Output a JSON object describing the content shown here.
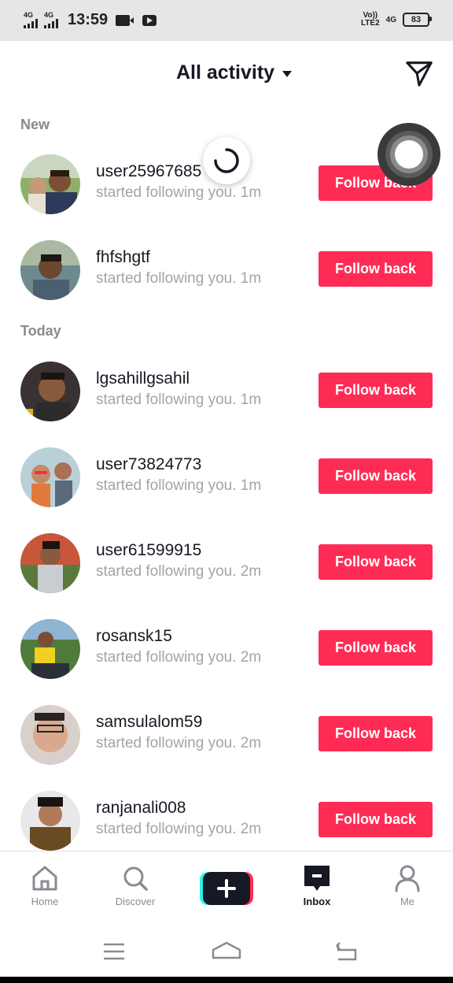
{
  "status_bar": {
    "network_1": "4G",
    "network_2": "4G",
    "time": "13:59",
    "volte_top": "Vo))",
    "volte_bottom": "LTE2",
    "net_right": "4G",
    "battery": "83"
  },
  "header": {
    "title": "All activity"
  },
  "sections": {
    "new": "New",
    "today": "Today"
  },
  "notifications": [
    {
      "username": "user25967685",
      "text": "started following you.",
      "time": "1m",
      "button": "Follow back"
    },
    {
      "username": "fhfshgtf",
      "text": "started following you.",
      "time": "1m",
      "button": "Follow back"
    },
    {
      "username": "lgsahillgsahil",
      "text": "started following you.",
      "time": "1m",
      "button": "Follow back"
    },
    {
      "username": "user73824773",
      "text": "started following you.",
      "time": "1m",
      "button": "Follow back"
    },
    {
      "username": "user61599915",
      "text": "started following you.",
      "time": "2m",
      "button": "Follow back"
    },
    {
      "username": "rosansk15",
      "text": "started following you.",
      "time": "2m",
      "button": "Follow back"
    },
    {
      "username": "samsulalom59",
      "text": "started following you.",
      "time": "2m",
      "button": "Follow back"
    },
    {
      "username": "ranjanali008",
      "text": "started following you.",
      "time": "2m",
      "button": "Follow back"
    }
  ],
  "tabs": [
    {
      "label": "Home",
      "icon": "home-icon"
    },
    {
      "label": "Discover",
      "icon": "search-icon"
    },
    {
      "label": "",
      "icon": "plus-icon"
    },
    {
      "label": "Inbox",
      "icon": "inbox-icon"
    },
    {
      "label": "Me",
      "icon": "profile-icon"
    }
  ],
  "colors": {
    "accent": "#fe2c55",
    "text_primary": "#161823",
    "text_secondary": "#a3a4a8"
  }
}
